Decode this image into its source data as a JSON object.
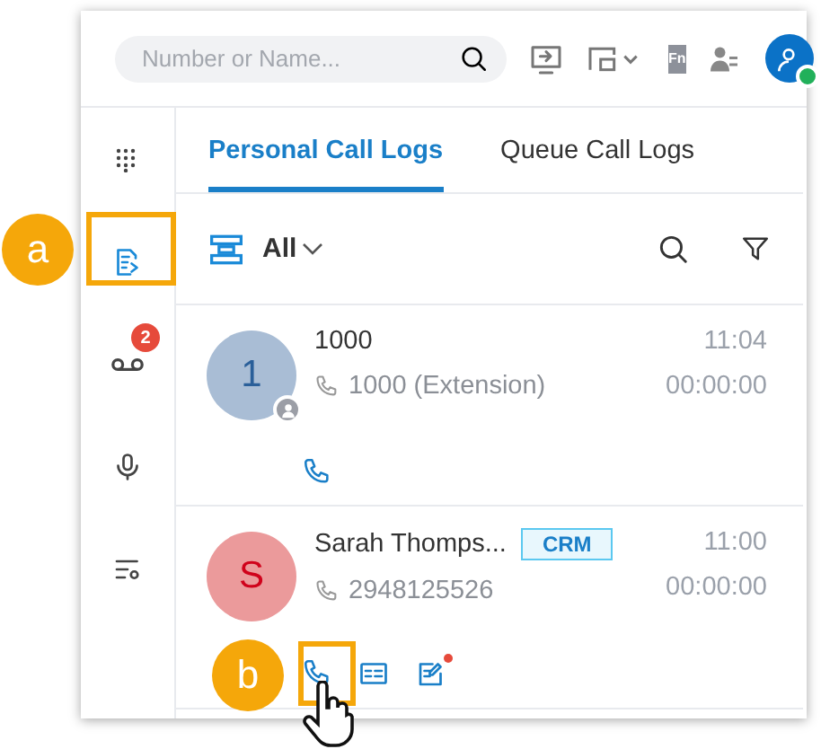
{
  "search": {
    "placeholder": "Number or Name..."
  },
  "header": {
    "fn_label": "Fn",
    "online": true
  },
  "sidebar": [
    {
      "kind": "dialpad",
      "selected": false
    },
    {
      "kind": "logs",
      "selected": true
    },
    {
      "kind": "voicemail",
      "selected": false,
      "badge": "2"
    },
    {
      "kind": "mic",
      "selected": false
    },
    {
      "kind": "settings",
      "selected": false
    }
  ],
  "tabs": [
    {
      "label": "Personal Call Logs",
      "selected": true
    },
    {
      "label": "Queue Call Logs",
      "selected": false
    }
  ],
  "filter": {
    "label": "All"
  },
  "logs": [
    {
      "initial": "1",
      "name": "1000",
      "number": "1000 (Extension)",
      "time": "11:04",
      "duration": "00:00:00",
      "color": "#a9bdd5",
      "kind": "extension",
      "actions": [
        {
          "kind": "call",
          "unread": false
        }
      ]
    },
    {
      "initial": "S",
      "name": "Sarah Thomps...",
      "tag": "CRM",
      "number": "2948125526",
      "time": "11:00",
      "duration": "00:00:00",
      "color": "#eb9a9b",
      "kind": "external",
      "actions": [
        {
          "kind": "call",
          "unread": false
        },
        {
          "kind": "contact",
          "unread": false
        },
        {
          "kind": "note",
          "unread": true
        }
      ]
    }
  ],
  "annotations": [
    {
      "label": "a"
    },
    {
      "label": "b"
    }
  ]
}
